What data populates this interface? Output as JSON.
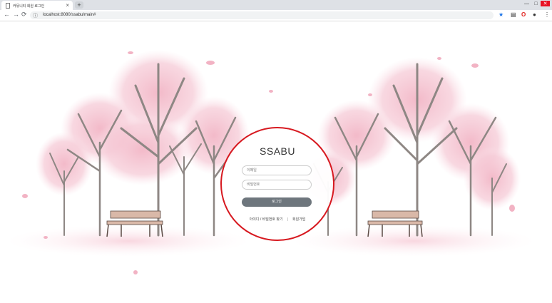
{
  "browser": {
    "tab_title": "커뮤니티 회원 로그인",
    "tab_close": "×",
    "new_tab": "+",
    "url": "localhost:8080/ssabu/main#",
    "window_controls": [
      "—",
      "□",
      "✕"
    ]
  },
  "login": {
    "brand": "SSABU",
    "email_placeholder": "이메일",
    "password_placeholder": "비밀번호",
    "login_button": "로그인",
    "find_link": "아이디 / 비밀번호 찾기",
    "separator": "|",
    "signup_link": "회원가입"
  },
  "colors": {
    "accent_ring": "#d71920",
    "button": "#6e767d",
    "blossom": "#f4c2cf",
    "trunk": "#8e8784"
  }
}
